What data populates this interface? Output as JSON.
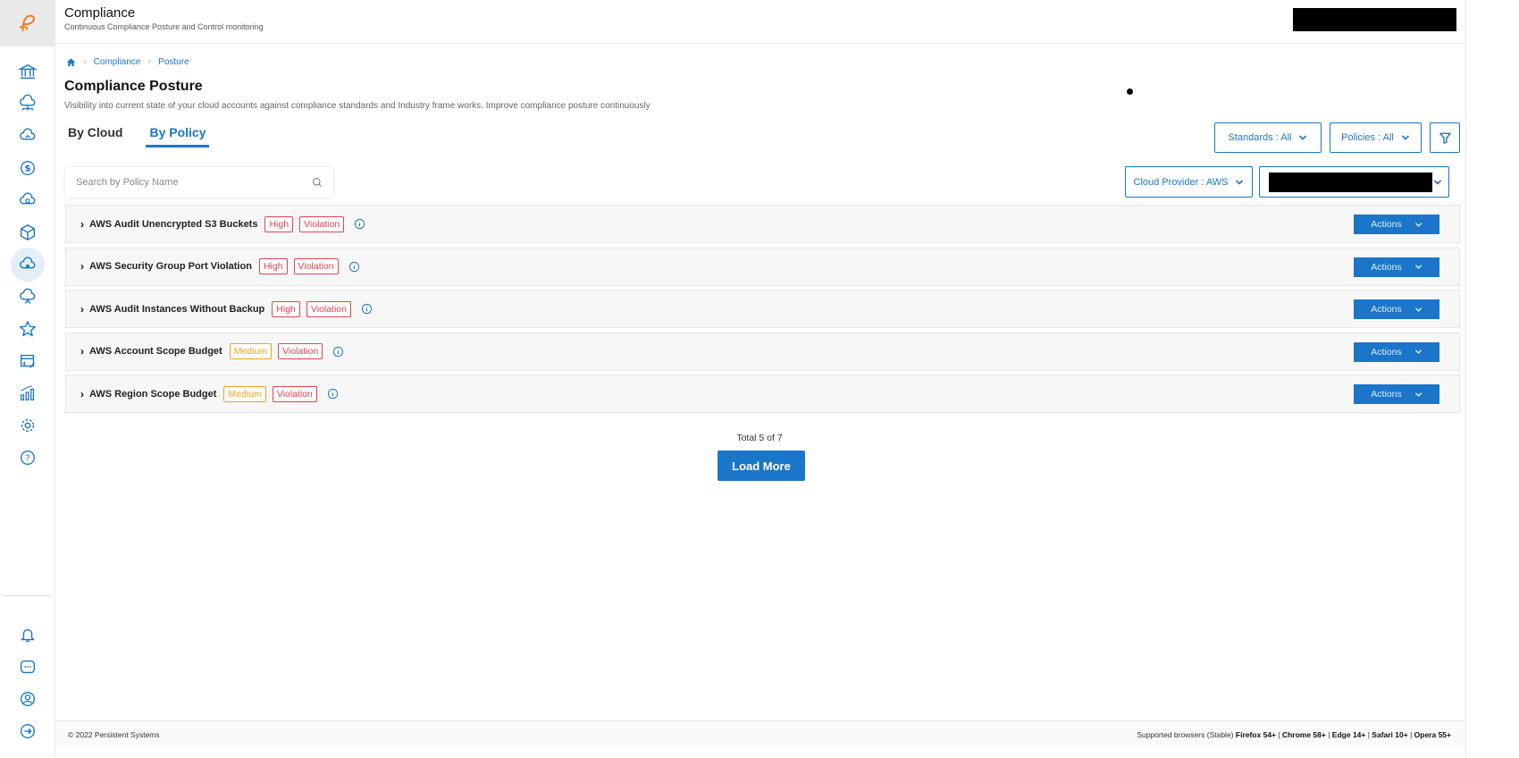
{
  "header": {
    "title": "Compliance",
    "subtitle": "Continuous Compliance Posture and Control monitoring"
  },
  "breadcrumb": {
    "items": [
      "Compliance",
      "Posture"
    ]
  },
  "page": {
    "title": "Compliance Posture",
    "description": "Visibility into current state of your cloud accounts against compliance standards and Industry frame works. Improve compliance posture continuously"
  },
  "tabs": [
    {
      "label": "By Cloud",
      "active": false
    },
    {
      "label": "By Policy",
      "active": true
    }
  ],
  "filters": {
    "standards": "Standards : All",
    "policies": "Policies : All",
    "cloud_provider": "Cloud Provider : AWS"
  },
  "search": {
    "placeholder": "Search by Policy Name",
    "value": ""
  },
  "policies": [
    {
      "name": "AWS Audit Unencrypted S3 Buckets",
      "severity": "High",
      "status": "Violation",
      "action": "Actions"
    },
    {
      "name": "AWS Security Group Port Violation",
      "severity": "High",
      "status": "Violation",
      "action": "Actions"
    },
    {
      "name": "AWS Audit Instances Without Backup",
      "severity": "High",
      "status": "Violation",
      "action": "Actions"
    },
    {
      "name": "AWS Account Scope Budget",
      "severity": "Medium",
      "status": "Violation",
      "action": "Actions"
    },
    {
      "name": "AWS Region Scope Budget",
      "severity": "Medium",
      "status": "Violation",
      "action": "Actions"
    }
  ],
  "pagination": {
    "total_text": "Total 5 of 7",
    "load_more": "Load More"
  },
  "footer": {
    "copyright": "© 2022 Persistent Systems",
    "browsers_prefix": "Supported browsers (Stable)",
    "browsers": [
      "Firefox 54+",
      "Chrome 58+",
      "Edge 14+",
      "Safari 10+",
      "Opera 55+"
    ]
  },
  "colors": {
    "accent": "#1b76c9",
    "high": "#e0454f",
    "medium": "#f2a21c",
    "logo": "#f07a2b"
  },
  "sidebar_icons": [
    "bank-icon",
    "cloud-network-icon",
    "cloud-sync-icon",
    "dollar-icon",
    "cloud-lock-icon",
    "cube-icon",
    "cloud-compliance-icon",
    "cloud-users-icon",
    "star-icon",
    "code-edit-icon",
    "analytics-icon",
    "gear-icon",
    "help-icon",
    "bell-icon",
    "chat-icon",
    "user-icon",
    "logout-icon"
  ]
}
